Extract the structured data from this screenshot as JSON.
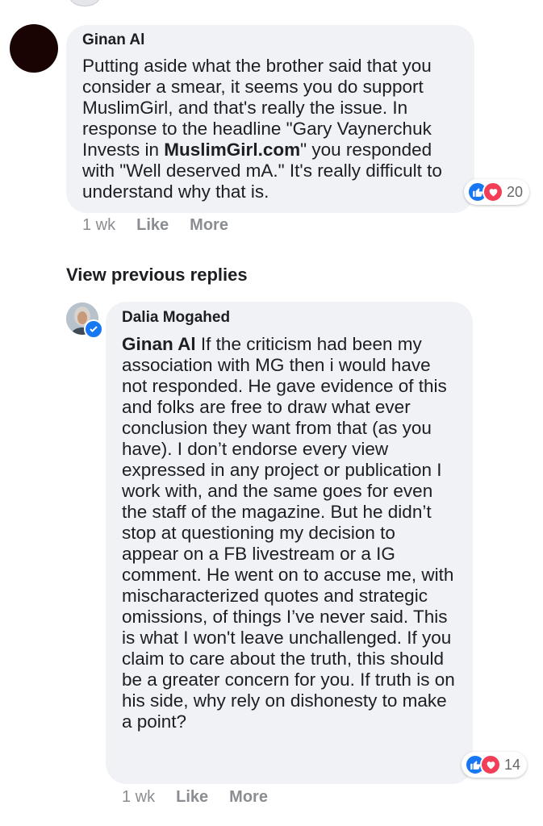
{
  "comments": [
    {
      "author": "Ginan Al",
      "text_before": "Putting aside what the brother said that you consider a smear, it seems you do support MuslimGirl, and that's really the issue. In response to the headline \"Gary Vaynerchuk Invests in ",
      "bold_link": "MuslimGirl.com",
      "text_after": "\" you responded with \"Well deserved mA.\" It's really difficult to understand why that is.",
      "reaction_count": "20",
      "time": "1 wk",
      "like_label": "Like",
      "more_label": "More"
    }
  ],
  "view_previous_label": "View previous replies",
  "reply": {
    "author": "Dalia Mogahed",
    "mention": "Ginan Al",
    "text": " If the criticism had been my association with MG then i would have not responded. He gave evidence of this and folks are free to draw what ever conclusion they want from that (as you have). I don’t endorse every view expressed in any project or publication I work with, and the same goes for even the staff of the magazine. But he didn’t stop at questioning my decision to appear on a FB livestream or a IG comment. He went on to accuse me, with mischaracterized quotes and strategic omissions, of things I’ve never said. This is what I won't leave unchallenged. If you claim to care about the truth, this should be a greater concern for you. If truth is on his side, why rely on dishonesty to make a point?",
    "reaction_count": "14",
    "time": "1 wk",
    "like_label": "Like",
    "more_label": "More"
  },
  "colors": {
    "bubble": "#f0f2f5",
    "like_blue": "#1877f2",
    "love_red": "#f33e58",
    "meta_gray": "#8a8d91"
  },
  "icons": [
    "like-reaction-icon",
    "love-reaction-icon",
    "verified-badge-icon"
  ]
}
